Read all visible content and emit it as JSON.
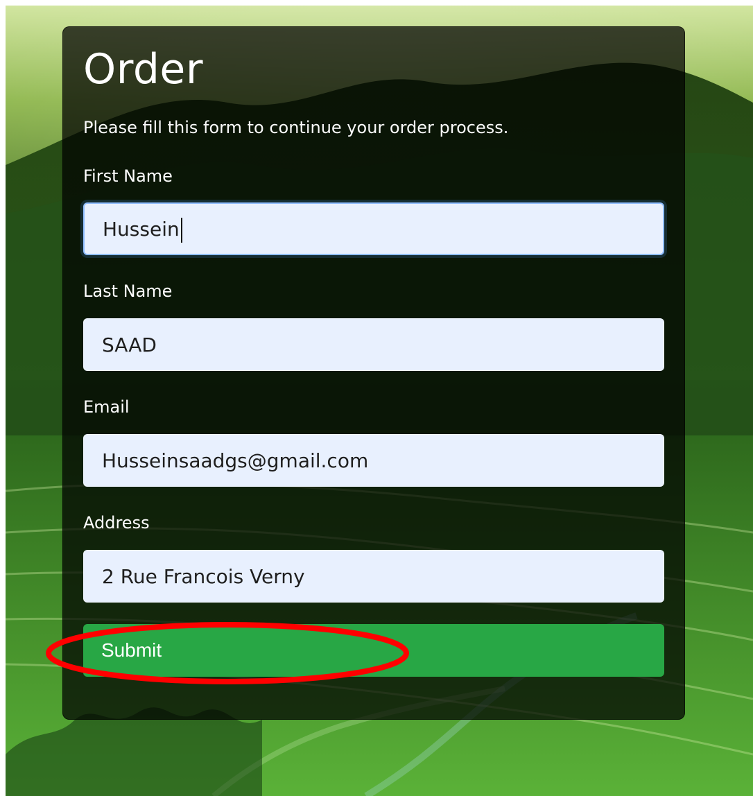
{
  "form": {
    "title": "Order",
    "subtitle": "Please fill this form to continue your order process.",
    "fields": [
      {
        "label": "First Name",
        "value": "Hussein"
      },
      {
        "label": "Last Name",
        "value": "SAAD"
      },
      {
        "label": "Email",
        "value": "Husseinsaadgs@gmail.com"
      },
      {
        "label": "Address",
        "value": "2 Rue Francois Verny"
      }
    ],
    "submit_label": "Submit"
  },
  "colors": {
    "card_bg": "#000000",
    "input_bg": "#e8f0fe",
    "submit_bg": "#28a745",
    "highlight": "#ff0000"
  }
}
